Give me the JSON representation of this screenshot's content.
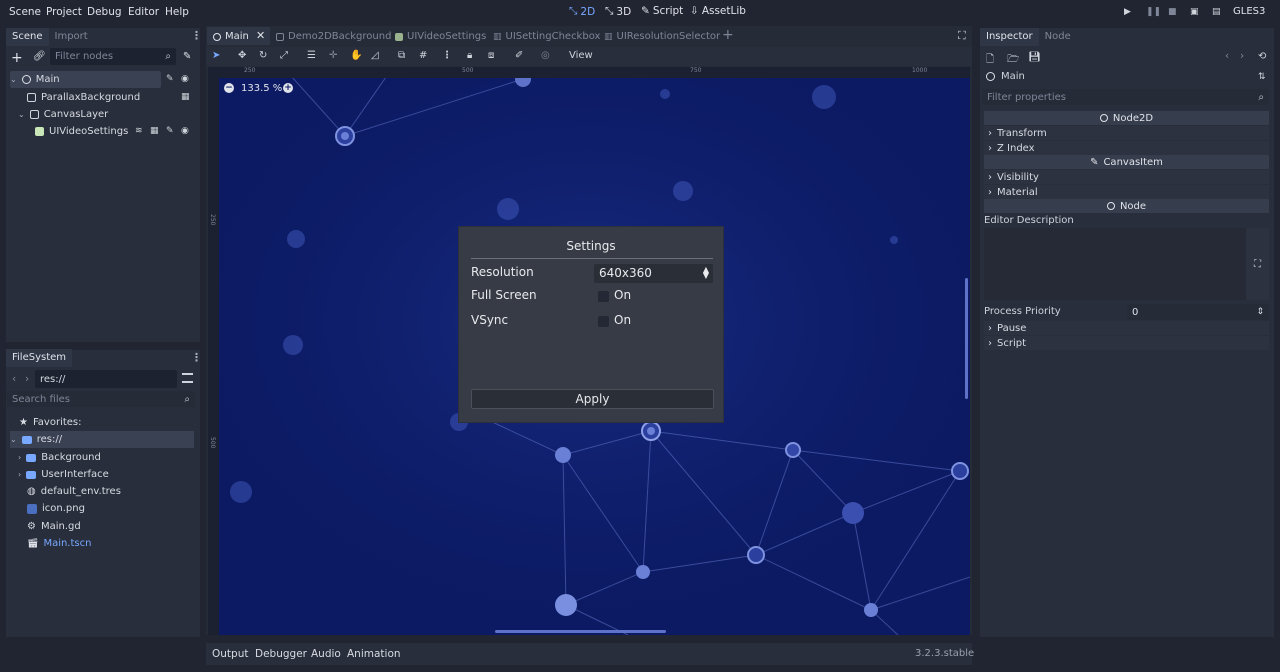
{
  "menubar": {
    "menus": [
      "Scene",
      "Project",
      "Debug",
      "Editor",
      "Help"
    ],
    "workspaces": [
      {
        "label": "2D",
        "icon": "2d-icon",
        "active": true
      },
      {
        "label": "3D",
        "icon": "3d-icon",
        "active": false
      },
      {
        "label": "Script",
        "icon": "script-icon",
        "active": false
      },
      {
        "label": "AssetLib",
        "icon": "assetlib-icon",
        "active": false
      }
    ],
    "renderer": "GLES3"
  },
  "scene_dock": {
    "tabs": [
      "Scene",
      "Import"
    ],
    "filter_placeholder": "Filter nodes",
    "tree": [
      {
        "label": "Main",
        "level": 0,
        "selected": true
      },
      {
        "label": "ParallaxBackground",
        "level": 1
      },
      {
        "label": "CanvasLayer",
        "level": 1
      },
      {
        "label": "UIVideoSettings",
        "level": 2
      }
    ]
  },
  "filesystem": {
    "tab": "FileSystem",
    "path": "res://",
    "search_placeholder": "Search files",
    "favorites_label": "Favorites:",
    "root_label": "res://",
    "entries": [
      {
        "label": "Background",
        "type": "folder"
      },
      {
        "label": "UserInterface",
        "type": "folder"
      },
      {
        "label": "default_env.tres",
        "type": "env"
      },
      {
        "label": "icon.png",
        "type": "image"
      },
      {
        "label": "Main.gd",
        "type": "script"
      },
      {
        "label": "Main.tscn",
        "type": "scene",
        "highlight": true
      }
    ]
  },
  "editor_tabs": [
    "Main",
    "Demo2DBackground",
    "UIVideoSettings",
    "UISettingCheckbox",
    "UIResolutionSelector"
  ],
  "toolbar": {
    "view_label": "View"
  },
  "viewport": {
    "zoom": "133.5 %",
    "ruler_h": [
      "250",
      "500",
      "750",
      "1000"
    ],
    "ruler_v": [
      "250",
      "500"
    ]
  },
  "dialog": {
    "title": "Settings",
    "resolution_label": "Resolution",
    "resolution_value": "640x360",
    "fullscreen_label": "Full Screen",
    "fullscreen_value": "On",
    "vsync_label": "VSync",
    "vsync_value": "On",
    "apply_label": "Apply"
  },
  "inspector": {
    "tabs": [
      "Inspector",
      "Node"
    ],
    "node_name": "Main",
    "filter_placeholder": "Filter properties",
    "section_node2d": "Node2D",
    "transform": "Transform",
    "zindex": "Z Index",
    "section_canvasitem": "CanvasItem",
    "visibility": "Visibility",
    "material": "Material",
    "section_node": "Node",
    "editor_description": "Editor Description",
    "process_priority_label": "Process Priority",
    "process_priority_value": "0",
    "pause": "Pause",
    "script": "Script"
  },
  "bottom_panel": {
    "tabs": [
      "Output",
      "Debugger",
      "Audio",
      "Animation"
    ],
    "version": "3.2.3.stable"
  },
  "colors": {
    "accent": "#78a8ff",
    "viewport_bg": "#0c1a63",
    "panel_bg": "#282e3b"
  }
}
